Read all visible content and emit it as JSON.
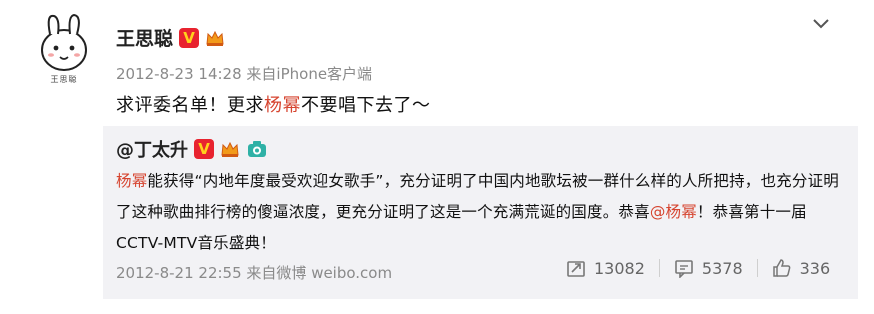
{
  "user": {
    "name": "王思聪",
    "verified_badge": "V",
    "avatar_caption": "王思聪"
  },
  "post": {
    "timestamp": "2012-8-23 14:28",
    "source_prefix": "来自",
    "source": "iPhone客户端",
    "text_before": "求评委名单！更求",
    "text_highlight": "杨幂",
    "text_after": "不要唱下去了～"
  },
  "quote": {
    "user": "@丁太升",
    "verified_badge": "V",
    "seg1_link": "杨幂",
    "seg2": "能获得“内地年度最受欢迎女歌手”，充分证明了中国内地歌坛被一群什么样的人所把持，也充分证明了这种歌曲排行榜的傻逼浓度，更充分证明了这是一个充满荒诞的国度。恭喜",
    "seg3_link": "@杨幂",
    "seg4": "！恭喜第十一届CCTV-MTV音乐盛典！",
    "timestamp": "2012-8-21 22:55",
    "source_prefix": "来自",
    "source": "微博 weibo.com"
  },
  "actions": {
    "repost_count": "13082",
    "comment_count": "5378",
    "like_count": "336"
  },
  "colors": {
    "accent": "#d6442f",
    "badge_red": "#e8232f",
    "quote_bg": "#f2f2f5",
    "meta_gray": "#8a8a8a"
  }
}
